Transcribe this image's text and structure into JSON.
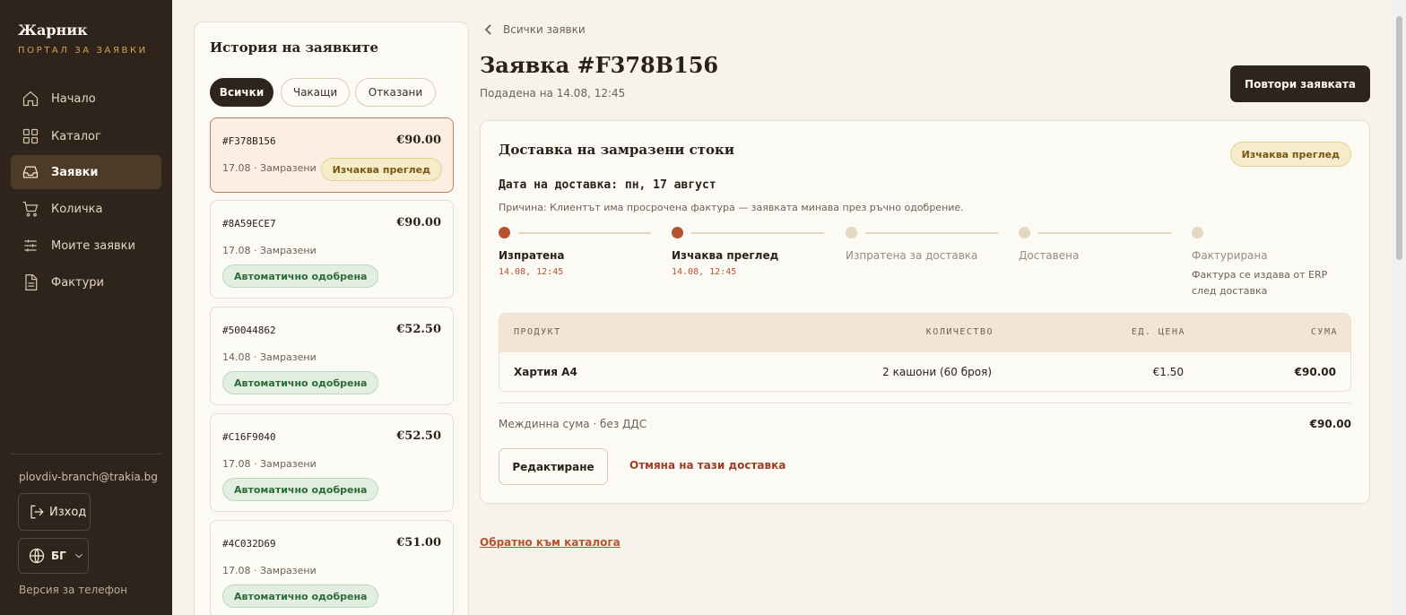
{
  "sidebar": {
    "brand": "Жарник",
    "brand_sub": "ПОРТАЛ ЗА ЗАЯВКИ",
    "items": [
      {
        "label": "Начало",
        "icon": "home-icon"
      },
      {
        "label": "Каталог",
        "icon": "grid-icon"
      },
      {
        "label": "Заявки",
        "icon": "inbox-icon",
        "active": true
      },
      {
        "label": "Количка",
        "icon": "cart-icon"
      },
      {
        "label": "Моите заявки",
        "icon": "sliders-icon"
      },
      {
        "label": "Фактури",
        "icon": "document-icon"
      }
    ],
    "email": "plovdiv-branch@trakia.bg",
    "logout_label": "Изход",
    "language": "БГ",
    "mobile_version": "Версия за телефон"
  },
  "history": {
    "title": "История на заявките",
    "filters": [
      "Всички",
      "Чакащи",
      "Отказани"
    ],
    "orders": [
      {
        "id": "#F378B156",
        "amount": "€90.00",
        "meta": "17.08 · Замразени",
        "status": "Изчаква преглед"
      },
      {
        "id": "#8A59ECE7",
        "amount": "€90.00",
        "meta": "17.08 · Замразени",
        "status": "Автоматично одобрена"
      },
      {
        "id": "#50044862",
        "amount": "€52.50",
        "meta": "14.08 · Замразени",
        "status": "Автоматично одобрена"
      },
      {
        "id": "#C16F9040",
        "amount": "€52.50",
        "meta": "17.08 · Замразени",
        "status": "Автоматично одобрена"
      },
      {
        "id": "#4C032D69",
        "amount": "€51.00",
        "meta": "17.08 · Замразени",
        "status": "Автоматично одобрена"
      }
    ]
  },
  "main": {
    "back_label": "Всички заявки",
    "title": "Заявка #F378B156",
    "submitted": "Подадена на 14.08, 12:45",
    "repeat_label": "Повтори заявката",
    "card": {
      "title": "Доставка на замразени стоки",
      "status": "Изчаква преглед",
      "delivery_date": "Дата на доставка: пн, 17 август",
      "reason": "Причина: Клиентът има просрочена фактура — заявката минава през ръчно одобрение.",
      "steps": [
        {
          "label": "Изпратена",
          "time": "14.08, 12:45",
          "done": true
        },
        {
          "label": "Изчаква преглед",
          "time": "14.08, 12:45",
          "done": true
        },
        {
          "label": "Изпратена за доставка",
          "done": false
        },
        {
          "label": "Доставена",
          "done": false
        },
        {
          "label": "Фактурирана",
          "note": "Фактура се издава от ERP след доставка",
          "done": false
        }
      ],
      "table": {
        "headers": [
          "ПРОДУКТ",
          "КОЛИЧЕСТВО",
          "ЕД. ЦЕНА",
          "СУМА"
        ],
        "rows": [
          {
            "product": "Хартия А4",
            "quantity": "2 кашони (60 броя)",
            "unit_price": "€1.50",
            "total": "€90.00"
          }
        ]
      },
      "subtotal_label": "Междинна сума · без ДДС",
      "subtotal_value": "€90.00",
      "edit_label": "Редактиране",
      "cancel_label": "Отмяна на тази доставка"
    },
    "catalog_link": "Обратно към каталога"
  },
  "colors": {
    "sidebar_bg": "#2e241b",
    "accent": "#b4532f",
    "review_badge": "#f7ecc9",
    "approved_badge": "#e2efe0",
    "page_bg": "#f7f3ea"
  }
}
